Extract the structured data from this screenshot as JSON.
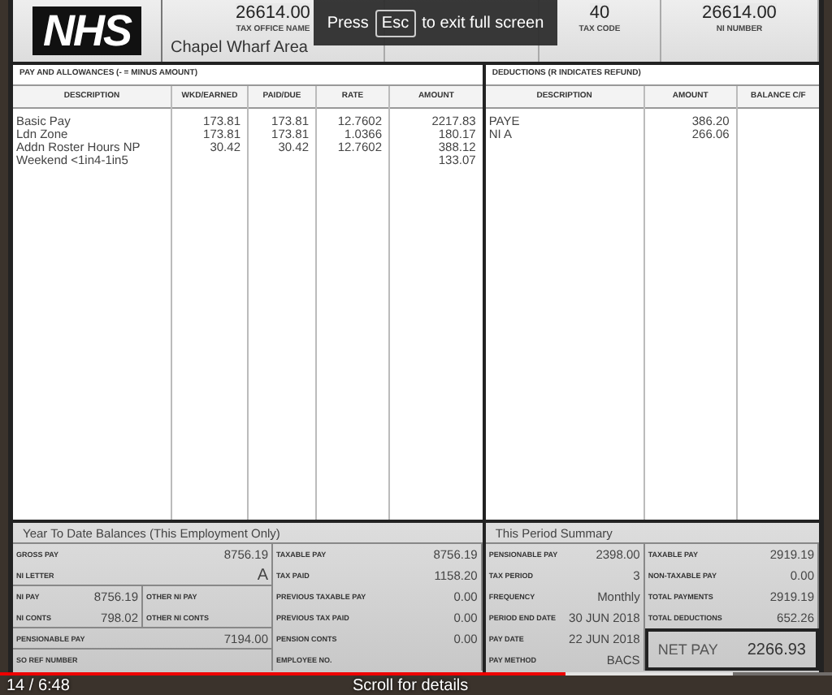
{
  "header": {
    "logo": "NHS",
    "cells": [
      {
        "value": "26614.00",
        "label": "TAX OFFICE NAME",
        "extra": "Chapel Wharf Area"
      },
      {
        "value": "40",
        "label": "TAX CODE"
      },
      {
        "value": "26614.00",
        "label": "NI NUMBER"
      }
    ]
  },
  "pay": {
    "title": "PAY AND ALLOWANCES (- = MINUS AMOUNT)",
    "columns": [
      "DESCRIPTION",
      "WKD/EARNED",
      "PAID/DUE",
      "RATE",
      "AMOUNT"
    ],
    "rows": [
      [
        "Basic Pay",
        "173.81",
        "173.81",
        "12.7602",
        "2217.83"
      ],
      [
        "Ldn Zone",
        "173.81",
        "173.81",
        "1.0366",
        "180.17"
      ],
      [
        "Addn Roster Hours NP",
        "30.42",
        "30.42",
        "12.7602",
        "388.12"
      ],
      [
        "Weekend <1in4-1in5",
        null,
        null,
        null,
        "133.07"
      ]
    ]
  },
  "deductions": {
    "title": "DEDUCTIONS (R INDICATES REFUND)",
    "columns": [
      "DESCRIPTION",
      "AMOUNT",
      "BALANCE C/F"
    ],
    "rows": [
      [
        "PAYE",
        "386.20",
        null
      ],
      [
        "NI A",
        "266.06",
        null
      ]
    ]
  },
  "ytd": {
    "title": "Year To Date Balances (This Employment Only)",
    "rows": [
      {
        "left": [
          {
            "label": "GROSS PAY",
            "value": "8756.19"
          }
        ],
        "right": {
          "label": "TAXABLE PAY",
          "value": "8756.19"
        }
      },
      {
        "left": [
          {
            "label": "NI LETTER",
            "value": "A"
          }
        ],
        "right": {
          "label": "TAX PAID",
          "value": "1158.20"
        }
      },
      {
        "left": [
          {
            "label": "NI PAY",
            "value": "8756.19"
          },
          {
            "label": "OTHER NI PAY"
          }
        ],
        "right": {
          "label": "PREVIOUS TAXABLE PAY",
          "value": "0.00"
        }
      },
      {
        "left": [
          {
            "label": "NI CONTS",
            "value": "798.02"
          },
          {
            "label": "OTHER NI CONTS"
          }
        ],
        "right": {
          "label": "PREVIOUS TAX PAID",
          "value": "0.00"
        }
      },
      {
        "left": [
          {
            "label": "PENSIONABLE PAY",
            "value": "7194.00"
          }
        ],
        "right": {
          "label": "PENSION CONTS",
          "value": "0.00"
        }
      },
      {
        "left": [
          {
            "label": "SO REF NUMBER"
          }
        ],
        "right": {
          "label": "EMPLOYEE NO."
        }
      }
    ]
  },
  "period": {
    "title": "This Period Summary",
    "left": [
      {
        "label": "PENSIONABLE PAY",
        "value": "2398.00"
      },
      {
        "label": "TAX PERIOD",
        "value": "3"
      },
      {
        "label": "FREQUENCY",
        "value": "Monthly"
      },
      {
        "label": "PERIOD END DATE",
        "value": "30 JUN 2018"
      },
      {
        "label": "PAY DATE",
        "value": "22 JUN 2018"
      },
      {
        "label": "PAY METHOD",
        "value": "BACS"
      }
    ],
    "right": [
      {
        "label": "TAXABLE PAY",
        "value": "2919.19"
      },
      {
        "label": "NON-TAXABLE PAY",
        "value": "0.00"
      },
      {
        "label": "TOTAL PAYMENTS",
        "value": "2919.19"
      },
      {
        "label": "TOTAL DEDUCTIONS",
        "value": "652.26"
      }
    ],
    "net_pay": {
      "label": "NET PAY",
      "value": "2266.93"
    }
  },
  "toast": {
    "before": "Press",
    "key": "Esc",
    "after": "to exit full screen"
  },
  "video": {
    "progress": {
      "level": 0.68
    },
    "buffer": {
      "level": 0.88
    },
    "time": "14 / 6:48",
    "hint": "Scroll for details"
  }
}
